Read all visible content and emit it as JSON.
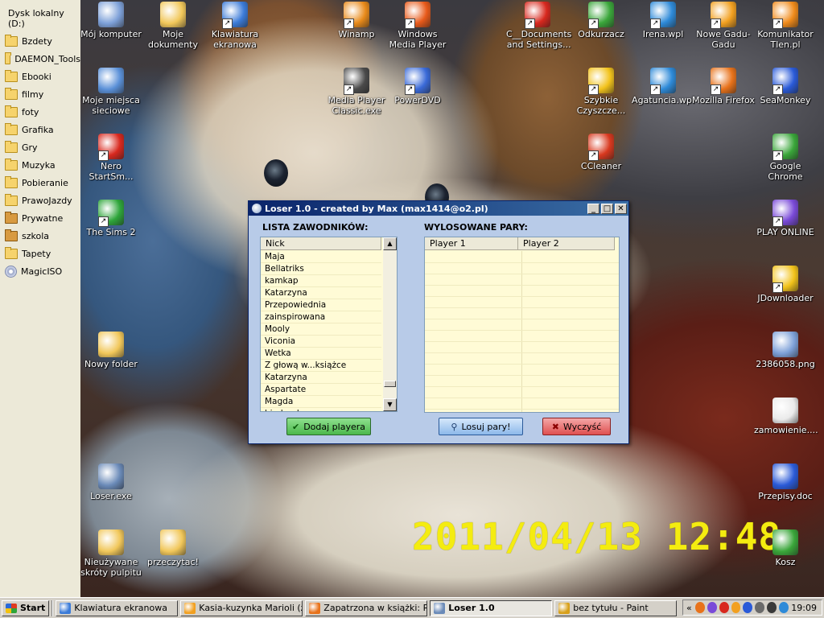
{
  "folder_panel": {
    "title": "Dysk lokalny (D:)",
    "items": [
      {
        "label": "Bzdety",
        "kind": "folder"
      },
      {
        "label": "DAEMON_Tools",
        "kind": "folder"
      },
      {
        "label": "Ebooki",
        "kind": "folder"
      },
      {
        "label": "filmy",
        "kind": "folder"
      },
      {
        "label": "foty",
        "kind": "folder"
      },
      {
        "label": "Grafika",
        "kind": "folder"
      },
      {
        "label": "Gry",
        "kind": "folder"
      },
      {
        "label": "Muzyka",
        "kind": "folder"
      },
      {
        "label": "Pobieranie",
        "kind": "folder"
      },
      {
        "label": "PrawoJazdy",
        "kind": "folder"
      },
      {
        "label": "Prywatne",
        "kind": "folder-locked"
      },
      {
        "label": "szkola",
        "kind": "folder-locked"
      },
      {
        "label": "Tapety",
        "kind": "folder"
      },
      {
        "label": "MagicISO",
        "kind": "disc"
      }
    ]
  },
  "desktop": {
    "timestamp": "2011/04/13 12:48",
    "icons": [
      {
        "label": "Mój komputer",
        "icon": "computer-icon",
        "color": "#7da0d8"
      },
      {
        "label": "Moje dokumenty",
        "icon": "documents-folder-icon",
        "color": "#f1c75a"
      },
      {
        "label": "Klawiatura ekranowa",
        "icon": "keyboard-icon",
        "color": "#3b7bd8"
      },
      {
        "label": "Winamp",
        "icon": "winamp-icon",
        "color": "#e88a1a"
      },
      {
        "label": "Windows Media Player",
        "icon": "media-player-icon",
        "color": "#e85a1a"
      },
      {
        "label": "C__Documents and Settings...",
        "icon": "pdf-icon",
        "color": "#d8281e"
      },
      {
        "label": "Odkurzacz",
        "icon": "cleaner-icon",
        "color": "#3aa63a"
      },
      {
        "label": "Irena.wpl",
        "icon": "playlist-icon",
        "color": "#2e8ad8"
      },
      {
        "label": "Nowe Gadu-Gadu",
        "icon": "gadu-gadu-icon",
        "color": "#f2a020"
      },
      {
        "label": "Komunikator Tlen.pl",
        "icon": "tlen-icon",
        "color": "#f08a1a"
      },
      {
        "label": "Moje miejsca sieciowe",
        "icon": "network-icon",
        "color": "#5a90d8"
      },
      {
        "label": "Media Player Classic.exe",
        "icon": "mpc-icon",
        "color": "#4a4a4a"
      },
      {
        "label": "PowerDVD",
        "icon": "powerdvd-icon",
        "color": "#3a6ad8"
      },
      {
        "label": "Szybkie Czyszcze...",
        "icon": "quick-clean-icon",
        "color": "#f2c21a"
      },
      {
        "label": "Agatuncia.wpl",
        "icon": "playlist-icon",
        "color": "#2e8ad8"
      },
      {
        "label": "Mozilla Firefox",
        "icon": "firefox-icon",
        "color": "#e8721a"
      },
      {
        "label": "SeaMonkey",
        "icon": "seamonkey-icon",
        "color": "#2a5ad8"
      },
      {
        "label": "Nero StartSm...",
        "icon": "nero-icon",
        "color": "#d8281e"
      },
      {
        "label": "CCleaner",
        "icon": "ccleaner-icon",
        "color": "#d8381e"
      },
      {
        "label": "Google Chrome",
        "icon": "chrome-icon",
        "color": "#3aa63a"
      },
      {
        "label": "The Sims 2",
        "icon": "sims-icon",
        "color": "#2ea53a"
      },
      {
        "label": "PLAY ONLINE",
        "icon": "play-online-icon",
        "color": "#7a4ad8"
      },
      {
        "label": "JDownloader",
        "icon": "jdownloader-icon",
        "color": "#f2c21a"
      },
      {
        "label": "Nowy folder",
        "icon": "folder-icon",
        "color": "#f1c75a"
      },
      {
        "label": "2386058.png",
        "icon": "image-file-icon",
        "color": "#7da0d8"
      },
      {
        "label": "zamowienie....",
        "icon": "text-file-icon",
        "color": "#eaeaea"
      },
      {
        "label": "Loser.exe",
        "icon": "magnifier-icon",
        "color": "#6a8ab8"
      },
      {
        "label": "Przepisy.doc",
        "icon": "word-doc-icon",
        "color": "#2a5ad8"
      },
      {
        "label": "Nieużywane skróty pulpitu",
        "icon": "folder-icon",
        "color": "#f1c75a"
      },
      {
        "label": "przeczytac!",
        "icon": "folder-icon",
        "color": "#f1c75a"
      },
      {
        "label": "Kosz",
        "icon": "recycle-bin-icon",
        "color": "#3aa63a"
      }
    ]
  },
  "window": {
    "title": "Loser 1.0 - created by Max (max1414@o2.pl)",
    "min_glyph": "_",
    "max_glyph": "□",
    "close_glyph": "✕",
    "players_label": "LISTA ZAWODNIKÓW:",
    "pairs_label": "WYLOSOWANE PARY:",
    "players_column": "Nick",
    "players": [
      "Maja",
      "Bellatriks",
      "kamkap",
      "Katarzyna",
      "Przepowiednia",
      "zainspirowana",
      "Mooly",
      "Viconia",
      "Wetka",
      "Z głową w...książce",
      "Katarzyna",
      "Aspartate",
      "Magda",
      "biedronka"
    ],
    "pairs_columns": [
      "Player 1",
      "Player 2"
    ],
    "buttons": {
      "add": "Dodaj playera",
      "draw": "Losuj pary!",
      "clear": "Wyczyść"
    }
  },
  "taskbar": {
    "start": "Start",
    "tasks": [
      {
        "label": "Klawiatura ekranowa",
        "icon": "keyboard-icon",
        "active": false
      },
      {
        "label": "Kasia-kuzynka Marioli (z...",
        "icon": "gadu-gadu-icon",
        "active": false
      },
      {
        "label": "Zapatrzona w książki: R...",
        "icon": "firefox-icon",
        "active": false
      },
      {
        "label": "Loser 1.0",
        "icon": "magnifier-icon",
        "active": true
      },
      {
        "label": "bez tytułu - Paint",
        "icon": "paint-icon",
        "active": false
      }
    ],
    "tray_expand": "«",
    "clock": "19:09"
  }
}
